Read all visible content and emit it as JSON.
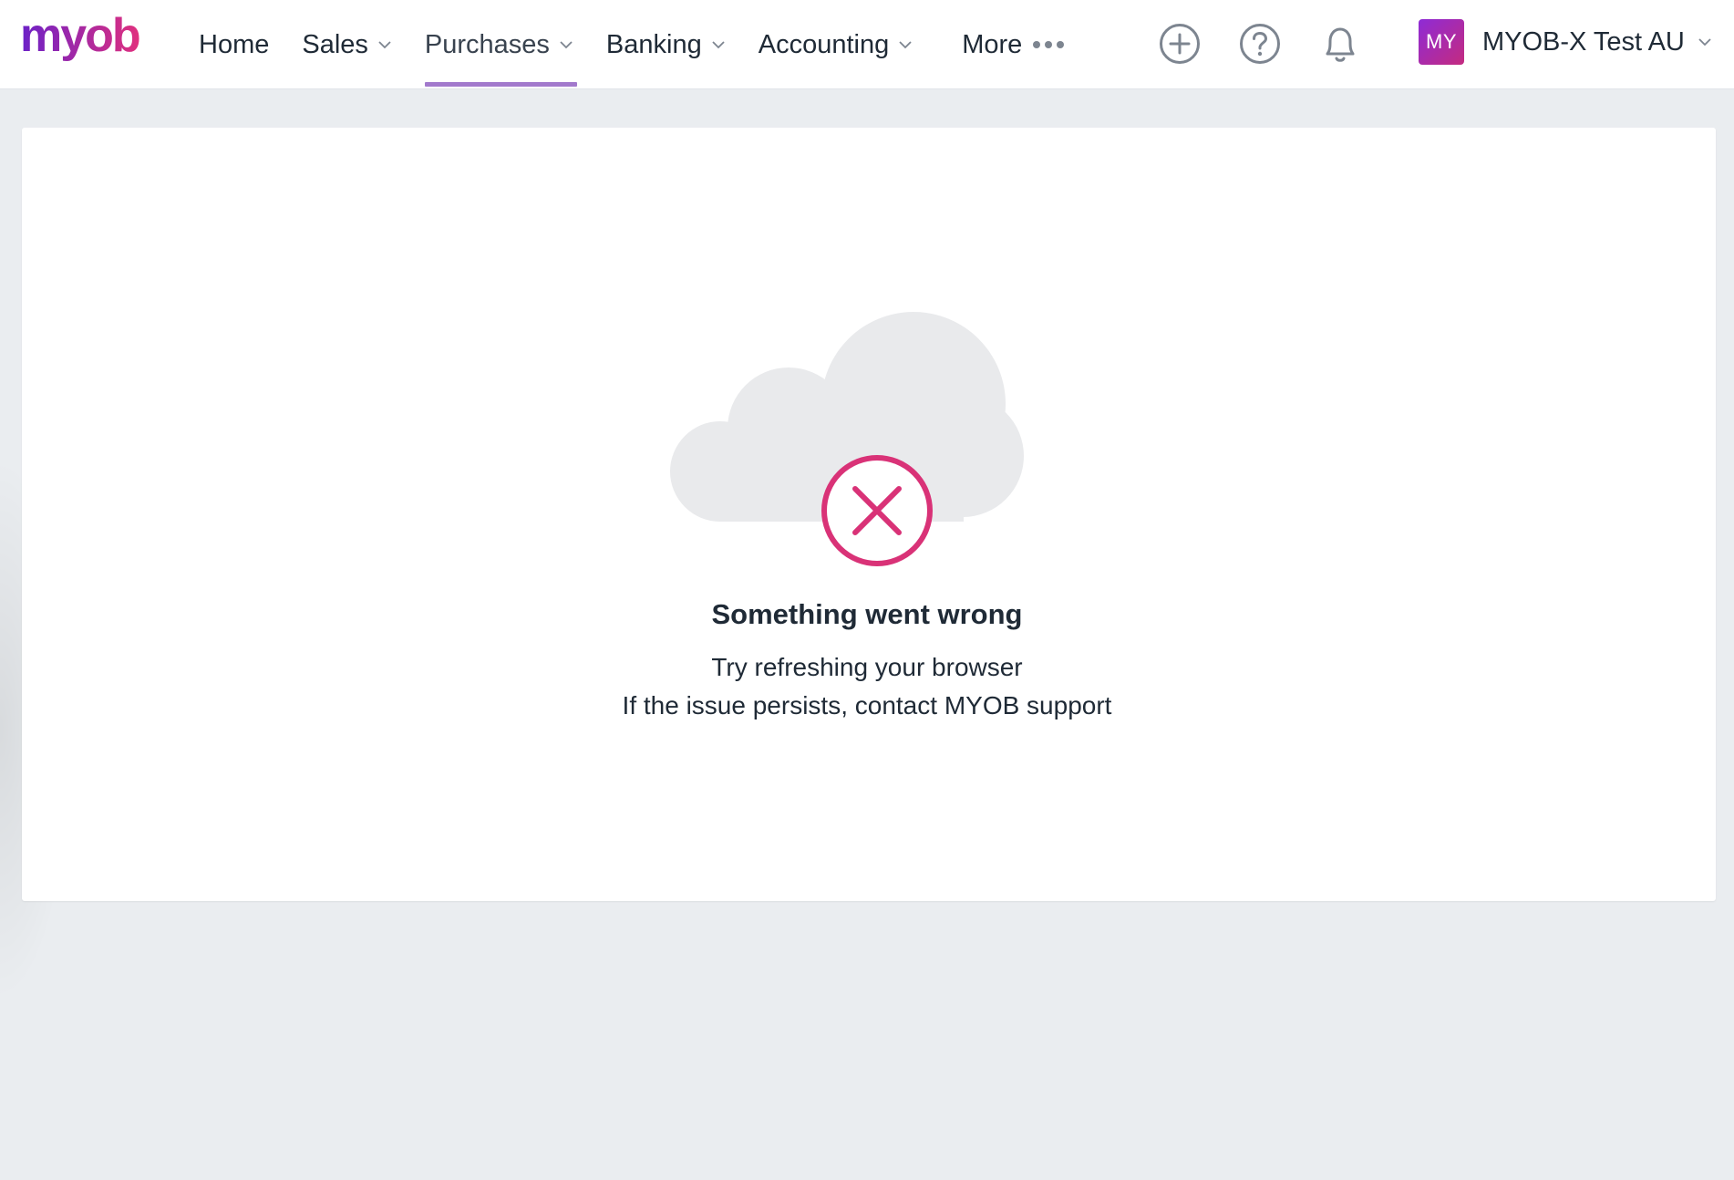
{
  "brand": {
    "logo_text": "myob",
    "logo_gradient": [
      "#6b21c8",
      "#e0307e"
    ]
  },
  "nav": {
    "items": [
      {
        "label": "Home",
        "dropdown": false
      },
      {
        "label": "Sales",
        "dropdown": true
      },
      {
        "label": "Purchases",
        "dropdown": true,
        "active": true
      },
      {
        "label": "Banking",
        "dropdown": true
      },
      {
        "label": "Accounting",
        "dropdown": true
      },
      {
        "label": "More",
        "dropdown": false,
        "dots": true
      }
    ]
  },
  "header_icons": [
    "add-circle-icon",
    "help-circle-icon",
    "bell-icon"
  ],
  "account": {
    "initials": "MY",
    "name": "MYOB-X Test AU"
  },
  "error": {
    "title": "Something went wrong",
    "line1": "Try refreshing your browser",
    "line2": "If the issue persists, contact MYOB support",
    "icon": "cloud-error-icon"
  },
  "colors": {
    "active_tab_underline": "#a279cc",
    "error_accent": "#d93277",
    "cloud": "#e9eaec",
    "page_bg": "#eaedf0"
  }
}
